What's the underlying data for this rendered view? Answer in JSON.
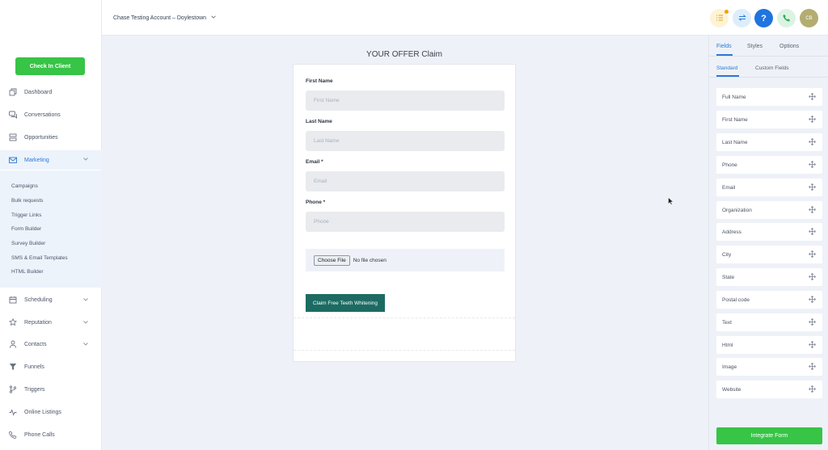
{
  "header": {
    "account": "Chase Testing Account – Doylestown",
    "avatar_initials": "CB",
    "help_label": "?"
  },
  "sidebar": {
    "checkin_label": "Check In Client",
    "items": [
      {
        "label": "Dashboard",
        "icon": "dashboard-icon"
      },
      {
        "label": "Conversations",
        "icon": "chat-icon"
      },
      {
        "label": "Opportunities",
        "icon": "opportunities-icon"
      },
      {
        "label": "Marketing",
        "icon": "mail-icon"
      },
      {
        "label": "Scheduling",
        "icon": "calendar-icon"
      },
      {
        "label": "Reputation",
        "icon": "star-icon"
      },
      {
        "label": "Contacts",
        "icon": "person-icon"
      },
      {
        "label": "Funnels",
        "icon": "funnel-icon"
      },
      {
        "label": "Triggers",
        "icon": "branch-icon"
      },
      {
        "label": "Online Listings",
        "icon": "pulse-icon"
      },
      {
        "label": "Phone Calls",
        "icon": "phone-icon"
      }
    ],
    "marketing_sub": [
      "Campaigns",
      "Bulk requests",
      "Trigger Links",
      "Form Builder",
      "Survey Builder",
      "SMS & Email Templates",
      "HTML Builder"
    ]
  },
  "form": {
    "title": "YOUR OFFER Claim",
    "fields": [
      {
        "label": "First Name",
        "placeholder": "First Name"
      },
      {
        "label": "Last Name",
        "placeholder": "Last Name"
      },
      {
        "label": "Email *",
        "placeholder": "Email"
      },
      {
        "label": "Phone *",
        "placeholder": "Phone"
      }
    ],
    "file_button": "Choose File",
    "file_status": "No file chosen",
    "submit_label": "Claim Free Teeth Whitening"
  },
  "panel": {
    "tabs": [
      "Fields",
      "Styles",
      "Options"
    ],
    "active_tab": "Fields",
    "subtabs": [
      "Standard",
      "Custom Fields"
    ],
    "active_subtab": "Standard",
    "fields": [
      "Full Name",
      "First Name",
      "Last Name",
      "Phone",
      "Email",
      "Organization",
      "Address",
      "City",
      "State",
      "Postal code",
      "Text",
      "Html",
      "Image",
      "Website"
    ],
    "integrate_label": "Integrate Form"
  },
  "colors": {
    "accent_green": "#37c447",
    "accent_blue": "#2b78d4",
    "submit_teal": "#1c6b63"
  }
}
